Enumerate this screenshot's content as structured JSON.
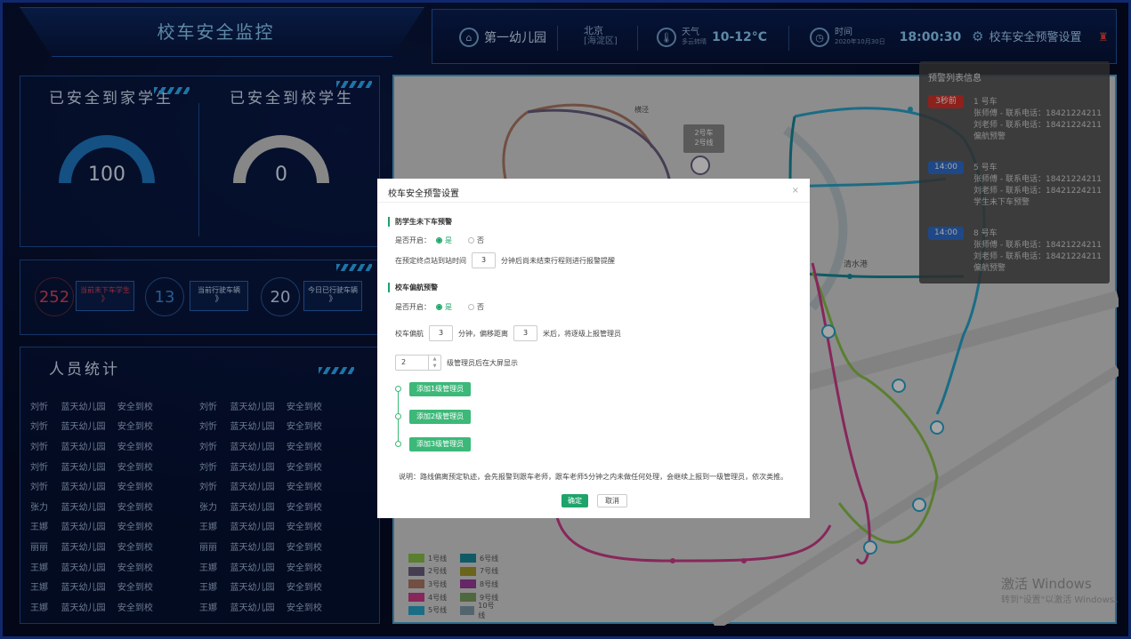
{
  "header": {
    "title": "校车安全监控",
    "school": "第一幼儿园",
    "city": "北京",
    "district": "[海淀区]",
    "weather_label": "天气",
    "weather_desc": "多云转晴",
    "temperature": "10-12°C",
    "time_label": "时间",
    "date": "2020年10月30日",
    "time": "18:00:30",
    "settings_label": "校车安全预警设置"
  },
  "home_panel": {
    "title_home": "已安全到家学生",
    "title_school": "已安全到校学生",
    "home_value": "100",
    "school_value": "0"
  },
  "stats": [
    {
      "value": "252",
      "label": "当前未下车学生",
      "arrow": "》",
      "color": "#e0465a"
    },
    {
      "value": "13",
      "label": "当前行驶车辆",
      "arrow": "》",
      "color": "#3d8fe0"
    },
    {
      "value": "20",
      "label": "今日已行驶车辆",
      "arrow": "》",
      "color": "#cfe3ff"
    }
  ],
  "people": {
    "title": "人员统计",
    "rows": [
      [
        "刘忻",
        "蓝天幼儿园",
        "安全到校",
        "刘忻",
        "蓝天幼儿园",
        "安全到校"
      ],
      [
        "刘忻",
        "蓝天幼儿园",
        "安全到校",
        "刘忻",
        "蓝天幼儿园",
        "安全到校"
      ],
      [
        "刘忻",
        "蓝天幼儿园",
        "安全到校",
        "刘忻",
        "蓝天幼儿园",
        "安全到校"
      ],
      [
        "刘忻",
        "蓝天幼儿园",
        "安全到校",
        "刘忻",
        "蓝天幼儿园",
        "安全到校"
      ],
      [
        "刘忻",
        "蓝天幼儿园",
        "安全到校",
        "刘忻",
        "蓝天幼儿园",
        "安全到校"
      ],
      [
        "张力",
        "蓝天幼儿园",
        "安全到校",
        "张力",
        "蓝天幼儿园",
        "安全到校"
      ],
      [
        "王娜",
        "蓝天幼儿园",
        "安全到校",
        "王娜",
        "蓝天幼儿园",
        "安全到校"
      ],
      [
        "丽丽",
        "蓝天幼儿园",
        "安全到校",
        "丽丽",
        "蓝天幼儿园",
        "安全到校"
      ],
      [
        "王娜",
        "蓝天幼儿园",
        "安全到校",
        "王娜",
        "蓝天幼儿园",
        "安全到校"
      ],
      [
        "王娜",
        "蓝天幼儿园",
        "安全到校",
        "王娜",
        "蓝天幼儿园",
        "安全到校"
      ],
      [
        "王娜",
        "蓝天幼儿园",
        "安全到校",
        "王娜",
        "蓝天幼儿园",
        "安全到校"
      ]
    ]
  },
  "map": {
    "labels": {
      "hengjing": "横泾",
      "qingshui": "清水港",
      "bus_name": "2号车",
      "bus_line": "2号线"
    },
    "legend": [
      [
        {
          "name": "1号线",
          "color": "#8bc34a"
        },
        {
          "name": "6号线",
          "color": "#178a9c"
        }
      ],
      [
        {
          "name": "2号线",
          "color": "#6b6080"
        },
        {
          "name": "7号线",
          "color": "#a39a2c"
        }
      ],
      [
        {
          "name": "3号线",
          "color": "#b07a66"
        },
        {
          "name": "8号线",
          "color": "#9c3c9c"
        }
      ],
      [
        {
          "name": "4号线",
          "color": "#d03c8c"
        },
        {
          "name": "9号线",
          "color": "#7aa060"
        }
      ],
      [
        {
          "name": "5号线",
          "color": "#2aa6cc"
        },
        {
          "name": "10号线",
          "color": "#7f9ca8"
        }
      ]
    ],
    "watermark": "激活 Windows",
    "watermark_sub": "转到\"设置\"以激活 Windows。"
  },
  "alerts": {
    "title": "预警列表信息",
    "items": [
      {
        "tag": "3秒前",
        "tag_color": "#d9342b",
        "bus": "1 号车",
        "teacher1": "张师傅 - 联系电话：18421224211",
        "teacher2": "刘老师 - 联系电话：18421224211",
        "type": "偏航预警"
      },
      {
        "tag": "14:00",
        "tag_color": "#2f6fd0",
        "bus": "5 号车",
        "teacher1": "张师傅 - 联系电话：18421224211",
        "teacher2": "刘老师 - 联系电话：18421224211",
        "type": "学生未下车预警"
      },
      {
        "tag": "14:00",
        "tag_color": "#2f6fd0",
        "bus": "8 号车",
        "teacher1": "张师傅 - 联系电话：18421224211",
        "teacher2": "刘老师 - 联系电话：18421224211",
        "type": "偏航预警"
      }
    ]
  },
  "modal": {
    "title": "校车安全预警设置",
    "close": "×",
    "sec1": "防学生未下车预警",
    "enable_label": "是否开启：",
    "yes": "是",
    "no": "否",
    "time_prefix": "在预定终点站到站时间",
    "time_value": "3",
    "time_suffix": "分钟后尚未结束行程则进行报警提醒",
    "sec2": "校车偏航预警",
    "dev_prefix": "校车偏航",
    "dev_minutes": "3",
    "dev_mid": "分钟，偏移距离",
    "dev_meters": "3",
    "dev_suffix": "米后，将逐级上报管理员",
    "level_value": "2",
    "level_suffix": "级管理员后在大屏显示",
    "add1": "添加1级管理员",
    "add2": "添加2级管理员",
    "add3": "添加3级管理员",
    "note": "说明：路线偏离预定轨迹，会先报警到跟车老师，跟车老师5分钟之内未做任何处理，会继续上报到一级管理员，依次类推。",
    "ok": "确定",
    "cancel": "取消"
  }
}
